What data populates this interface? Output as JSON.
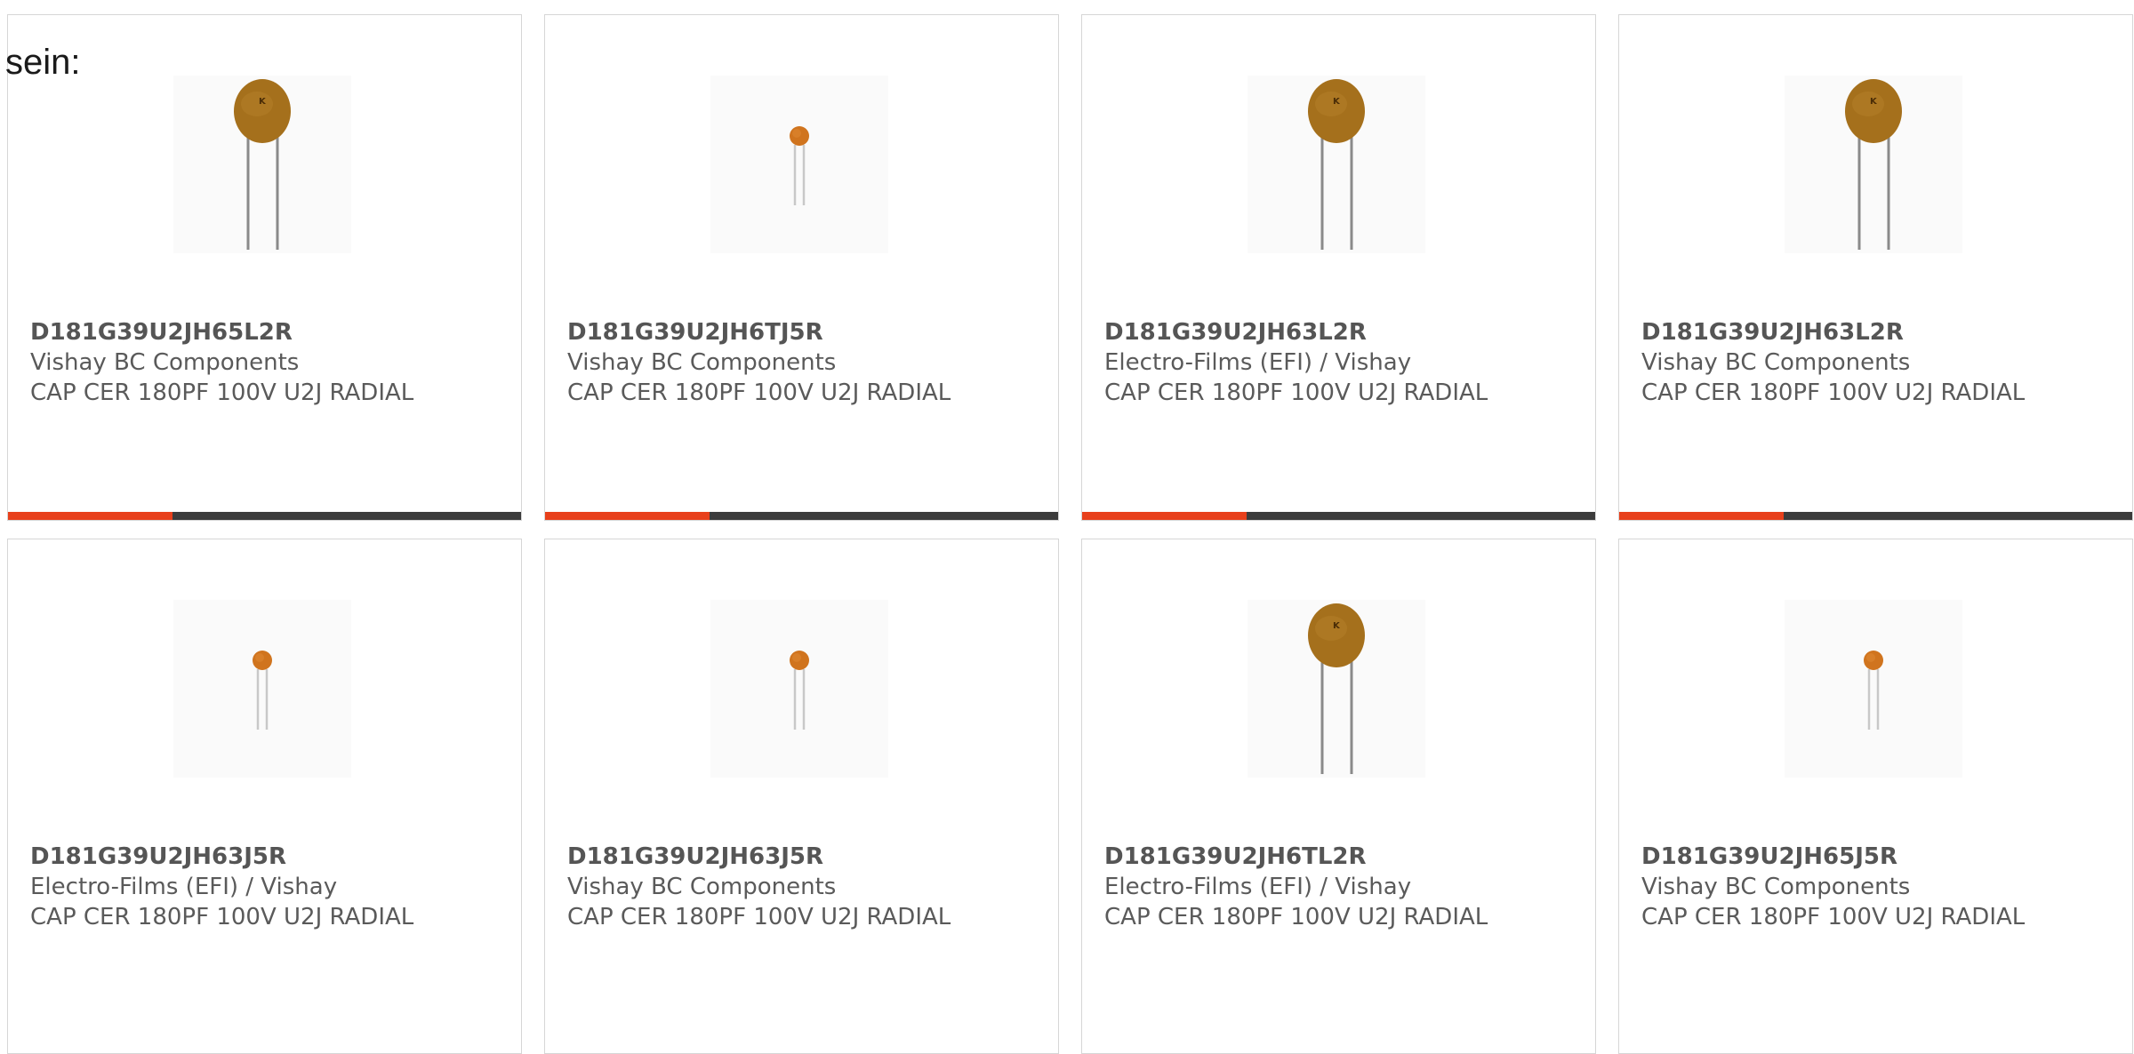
{
  "heading": "sein:",
  "colors": {
    "accent": "#e8401b",
    "bar_track": "#3c3c3c",
    "capacitor_large": "#a5701c",
    "capacitor_small": "#d0741e"
  },
  "cards": [
    {
      "part_number": "D181G39U2JH65L2R",
      "manufacturer": "Vishay BC Components",
      "description": "CAP CER 180PF 100V U2J RADIAL",
      "image": "capacitor-large-icon",
      "progress": 0.32
    },
    {
      "part_number": "D181G39U2JH6TJ5R",
      "manufacturer": "Vishay BC Components",
      "description": "CAP CER 180PF 100V U2J RADIAL",
      "image": "capacitor-small-icon",
      "progress": 0.32
    },
    {
      "part_number": "D181G39U2JH63L2R",
      "manufacturer": "Electro-Films (EFI) / Vishay",
      "description": "CAP CER 180PF 100V U2J RADIAL",
      "image": "capacitor-large-icon",
      "progress": 0.32
    },
    {
      "part_number": "D181G39U2JH63L2R",
      "manufacturer": "Vishay BC Components",
      "description": "CAP CER 180PF 100V U2J RADIAL",
      "image": "capacitor-large-icon",
      "progress": 0.32
    },
    {
      "part_number": "D181G39U2JH63J5R",
      "manufacturer": "Electro-Films (EFI) / Vishay",
      "description": "CAP CER 180PF 100V U2J RADIAL",
      "image": "capacitor-small-icon"
    },
    {
      "part_number": "D181G39U2JH63J5R",
      "manufacturer": "Vishay BC Components",
      "description": "CAP CER 180PF 100V U2J RADIAL",
      "image": "capacitor-small-icon"
    },
    {
      "part_number": "D181G39U2JH6TL2R",
      "manufacturer": "Electro-Films (EFI) / Vishay",
      "description": "CAP CER 180PF 100V U2J RADIAL",
      "image": "capacitor-large-icon"
    },
    {
      "part_number": "D181G39U2JH65J5R",
      "manufacturer": "Vishay BC Components",
      "description": "CAP CER 180PF 100V U2J RADIAL",
      "image": "capacitor-small-icon"
    }
  ]
}
